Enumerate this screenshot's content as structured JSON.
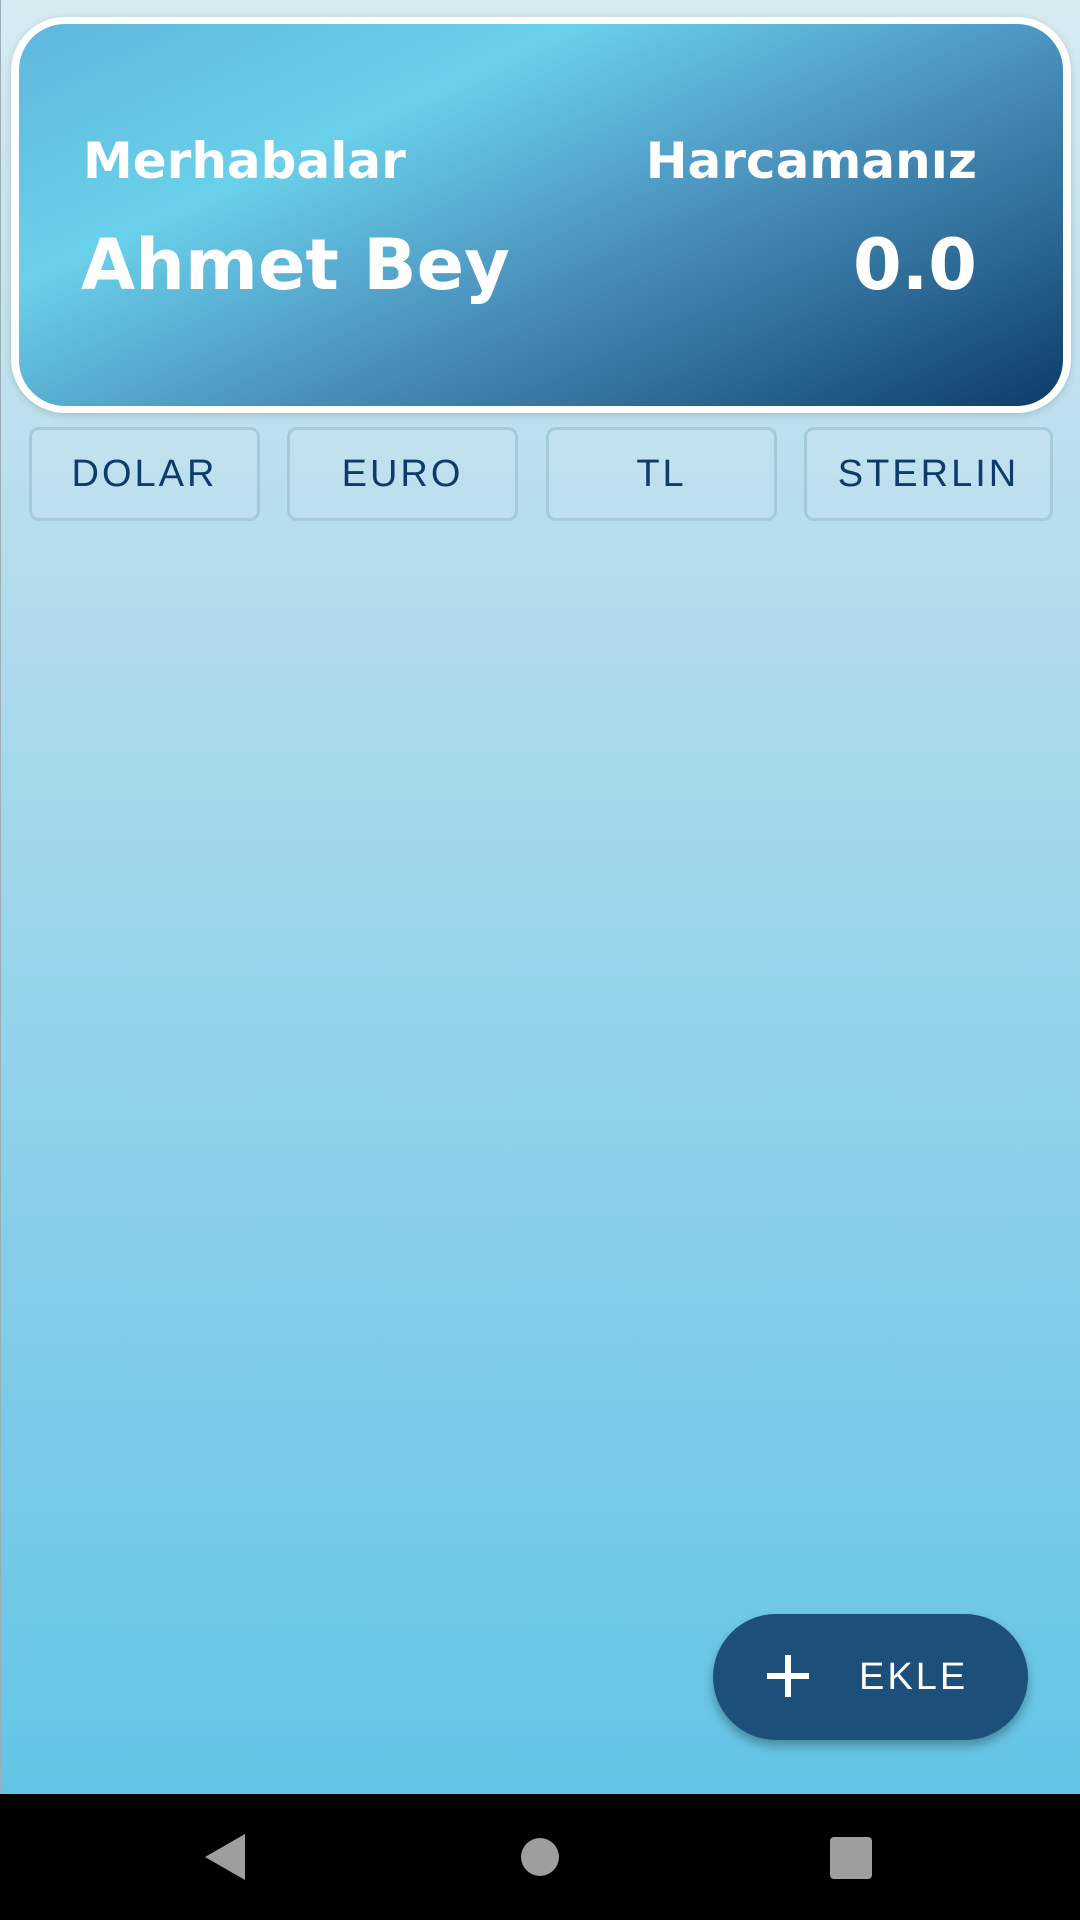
{
  "header": {
    "greeting_label": "Merhabalar",
    "user_name": "Ahmet Bey",
    "spending_label": "Harcamanız",
    "spending_value": "0.0"
  },
  "currencies": [
    {
      "label": "DOLAR"
    },
    {
      "label": "EURO"
    },
    {
      "label": "TL"
    },
    {
      "label": "STERLIN"
    }
  ],
  "fab": {
    "icon": "plus-icon",
    "label": "EKLE"
  },
  "navigation": {
    "back_icon": "back-triangle-icon",
    "home_icon": "home-circle-icon",
    "recents_icon": "recents-square-icon"
  },
  "colors": {
    "accent_dark": "#0e3b69",
    "fab_background": "#1d4f7b",
    "card_gradient_start": "#6ad0ea",
    "card_gradient_end": "#0e3b69"
  }
}
